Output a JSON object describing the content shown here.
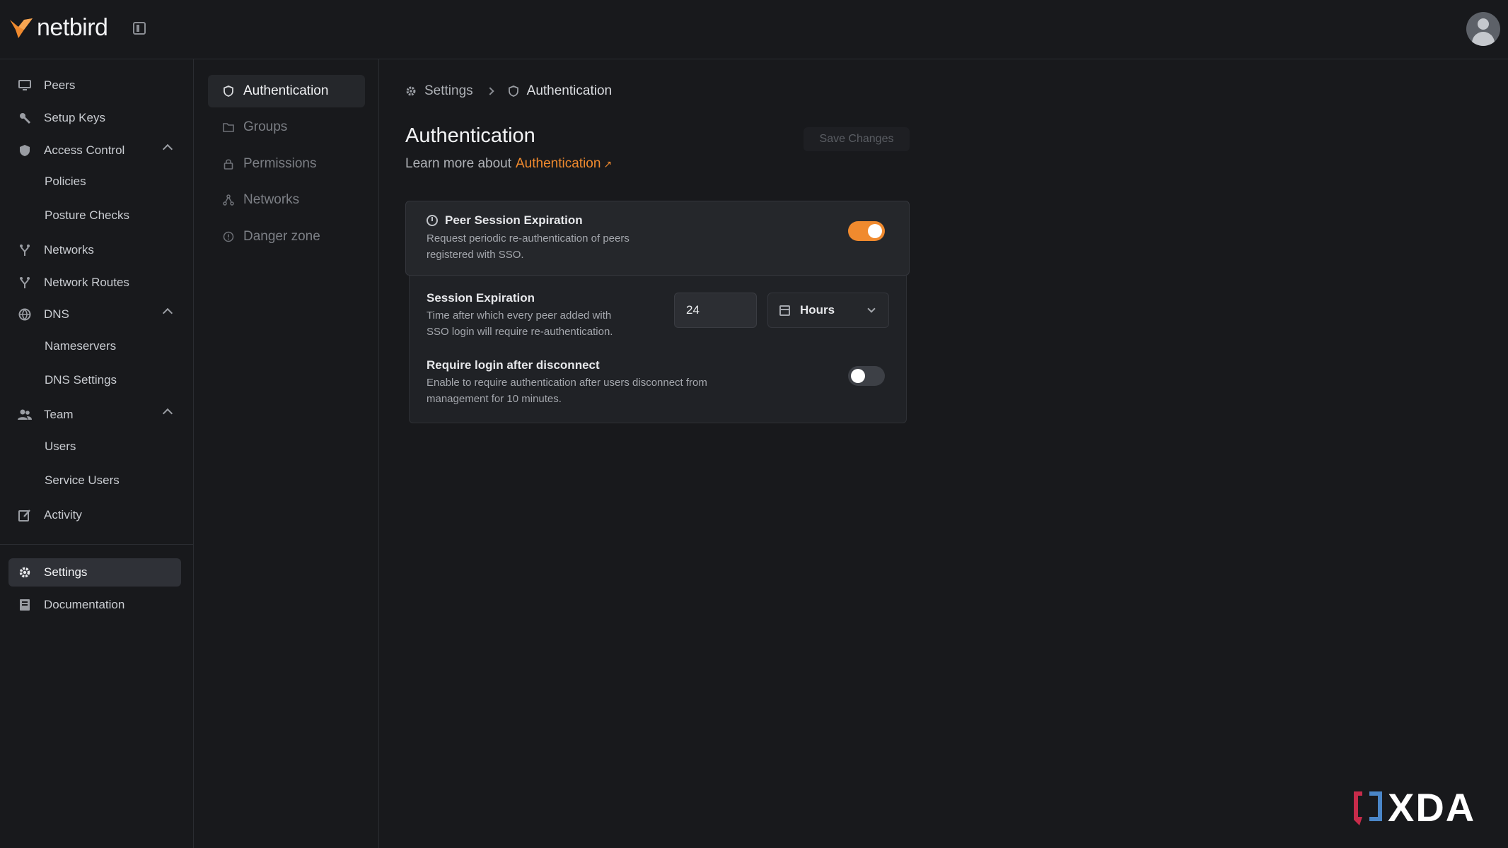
{
  "app": {
    "name": "netbird",
    "brand_color": "#f08a2e"
  },
  "sidebar": {
    "items": [
      {
        "label": "Peers",
        "icon": "monitor-icon"
      },
      {
        "label": "Setup Keys",
        "icon": "key-icon"
      },
      {
        "label": "Access Control",
        "icon": "shield-icon",
        "expanded": true,
        "children": [
          "Policies",
          "Posture Checks"
        ]
      },
      {
        "label": "Networks",
        "icon": "network-icon"
      },
      {
        "label": "Network Routes",
        "icon": "route-icon"
      },
      {
        "label": "DNS",
        "icon": "globe-icon",
        "expanded": true,
        "children": [
          "Nameservers",
          "DNS Settings"
        ]
      },
      {
        "label": "Team",
        "icon": "users-icon",
        "expanded": true,
        "children": [
          "Users",
          "Service Users"
        ]
      },
      {
        "label": "Activity",
        "icon": "activity-icon"
      },
      {
        "label": "Settings",
        "icon": "gear-icon",
        "active": true
      },
      {
        "label": "Documentation",
        "icon": "book-icon"
      }
    ]
  },
  "settings_nav": {
    "items": [
      {
        "label": "Authentication",
        "icon": "shield-outline-icon",
        "active": true
      },
      {
        "label": "Groups",
        "icon": "folder-icon"
      },
      {
        "label": "Permissions",
        "icon": "lock-icon"
      },
      {
        "label": "Networks",
        "icon": "network-nodes-icon"
      },
      {
        "label": "Danger zone",
        "icon": "alert-circle-icon"
      }
    ]
  },
  "breadcrumb": {
    "root": "Settings",
    "current": "Authentication"
  },
  "page": {
    "title": "Authentication",
    "learn_prefix": "Learn more about",
    "learn_link": "Authentication",
    "save_label": "Save Changes"
  },
  "peer_session": {
    "title": "Peer Session Expiration",
    "desc_line1": "Request periodic re-authentication of peers",
    "desc_line2": "registered with SSO.",
    "enabled": true
  },
  "session_expiration": {
    "title": "Session Expiration",
    "desc_line1": "Time after which every peer added with",
    "desc_line2": "SSO login will require re-authentication.",
    "value": "24",
    "unit": "Hours"
  },
  "require_login": {
    "title": "Require login after disconnect",
    "desc_line1": "Enable to require authentication after users disconnect from",
    "desc_line2": "management for 10 minutes.",
    "enabled": false
  },
  "watermark": {
    "text": "XDA"
  }
}
